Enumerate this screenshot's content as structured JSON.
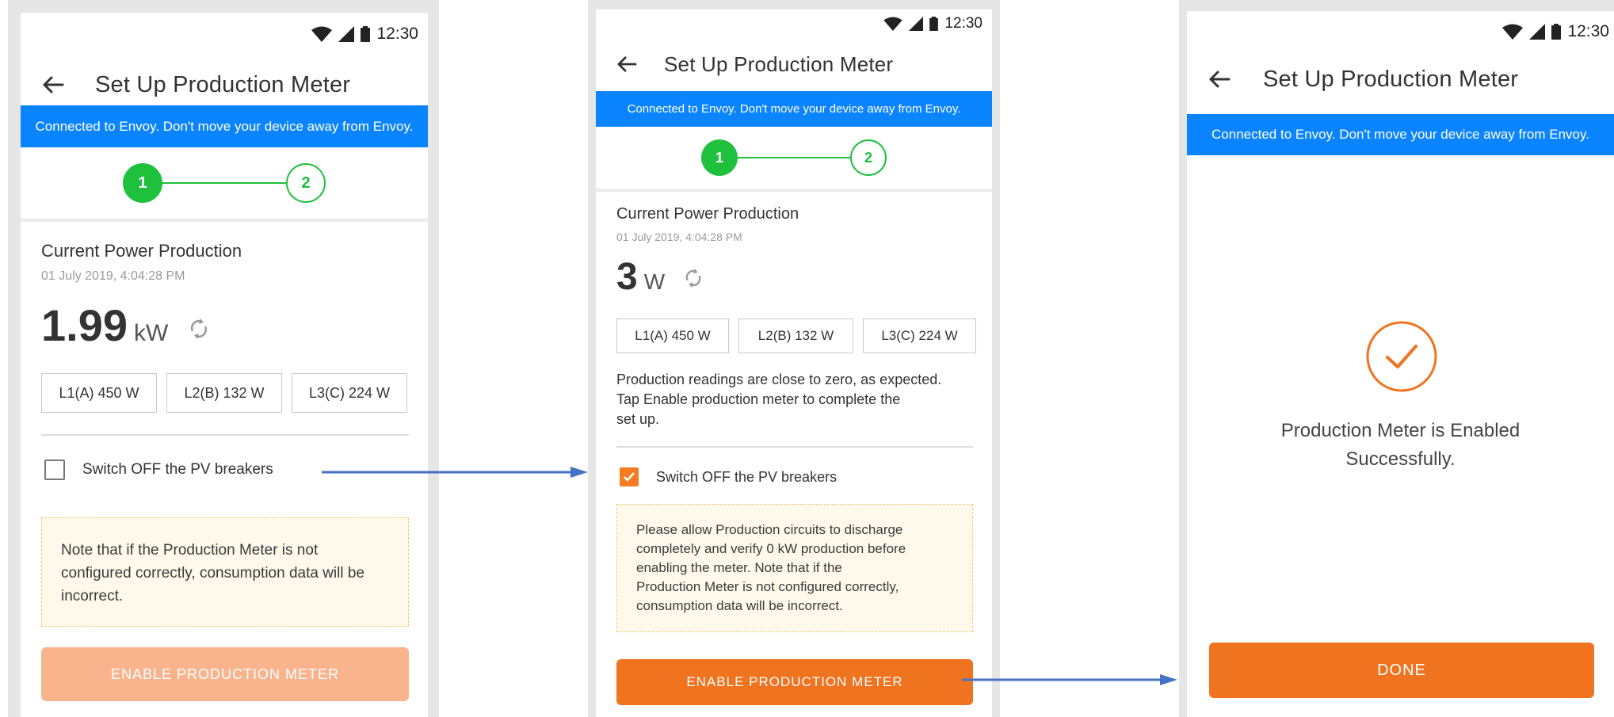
{
  "status_bar": {
    "time": "12:30"
  },
  "screens": [
    {
      "title": "Set Up Production Meter",
      "banner": "Connected to Envoy. Don't move your device away from Envoy.",
      "steps": [
        "1",
        "2"
      ],
      "section_title": "Current Power Production",
      "timestamp": "01 July 2019, 4:04:28 PM",
      "power_value": "1.99",
      "power_unit": "kW",
      "phases": [
        "L1(A) 450 W",
        "L2(B) 132 W",
        "L3(C) 224 W"
      ],
      "checkbox_label": "Switch OFF the PV breakers",
      "checkbox_checked": false,
      "note_lines": [
        "Note that if the Production Meter is not",
        "configured correctly, consumption data will be",
        "incorrect."
      ],
      "button_label": "ENABLE PRODUCTION METER",
      "button_enabled": false
    },
    {
      "title": "Set Up Production Meter",
      "banner": "Connected to Envoy. Don't move your device away from Envoy.",
      "steps": [
        "1",
        "2"
      ],
      "section_title": "Current Power Production",
      "timestamp": "01 July 2019, 4:04:28 PM",
      "power_value": "3",
      "power_unit": "W",
      "phases": [
        "L1(A) 450 W",
        "L2(B) 132 W",
        "L3(C) 224 W"
      ],
      "description_lines": [
        "Production readings are close to zero, as expected.",
        "Tap Enable production meter to complete the",
        "set up."
      ],
      "checkbox_label": "Switch OFF the PV breakers",
      "checkbox_checked": true,
      "note_lines": [
        "Please allow Production circuits to discharge",
        "completely and verify 0 kW production before",
        "enabling the meter. Note that if the",
        "Production Meter is not configured correctly,",
        "consumption data will be incorrect."
      ],
      "button_label": "ENABLE PRODUCTION METER",
      "button_enabled": true
    },
    {
      "title": "Set Up Production Meter",
      "banner": "Connected to Envoy. Don't move your device away from Envoy.",
      "success_lines": [
        "Production Meter is Enabled",
        "Successfully."
      ],
      "button_label": "DONE"
    }
  ],
  "colors": {
    "accent_orange": "#f07320",
    "disabled_orange": "#f9b48e",
    "banner_blue": "#0a84ff",
    "step_green": "#1ec03c",
    "flow_arrow_blue": "#4472c4"
  },
  "icons": {
    "back": "arrow-left-icon",
    "refresh": "refresh-icon",
    "success": "check-circle-icon",
    "wifi": "wifi-icon",
    "signal": "signal-icon",
    "battery": "battery-icon"
  }
}
